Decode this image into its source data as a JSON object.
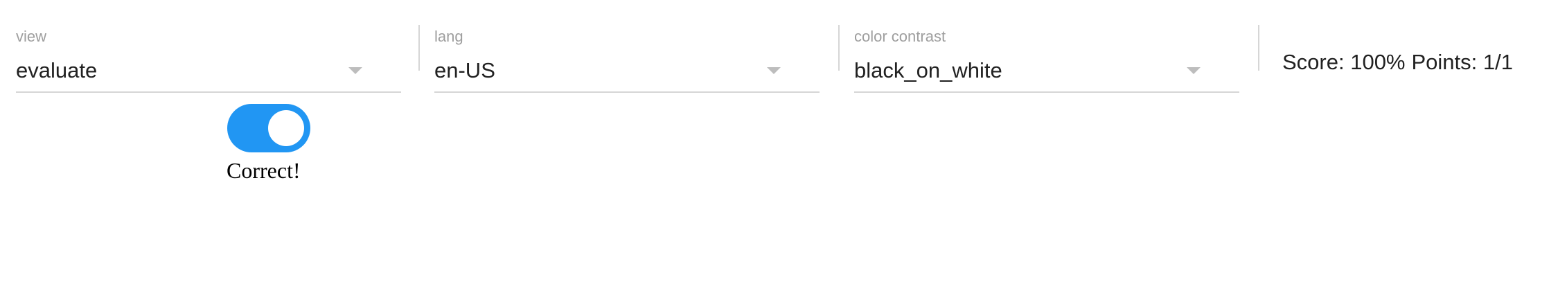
{
  "toolbar": {
    "view": {
      "label": "view",
      "value": "evaluate",
      "icon": "caret-down-icon"
    },
    "lang": {
      "label": "lang",
      "value": "en-US",
      "icon": "caret-down-icon"
    },
    "color_contrast": {
      "label": "color contrast",
      "value": "black_on_white",
      "icon": "caret-down-icon"
    },
    "score": {
      "score_text": "Score: 100%",
      "points_text": "Points: 1/1"
    }
  },
  "toggle": {
    "state": "on",
    "accent_color": "#2196f3"
  },
  "feedback": {
    "text": "Correct!"
  }
}
